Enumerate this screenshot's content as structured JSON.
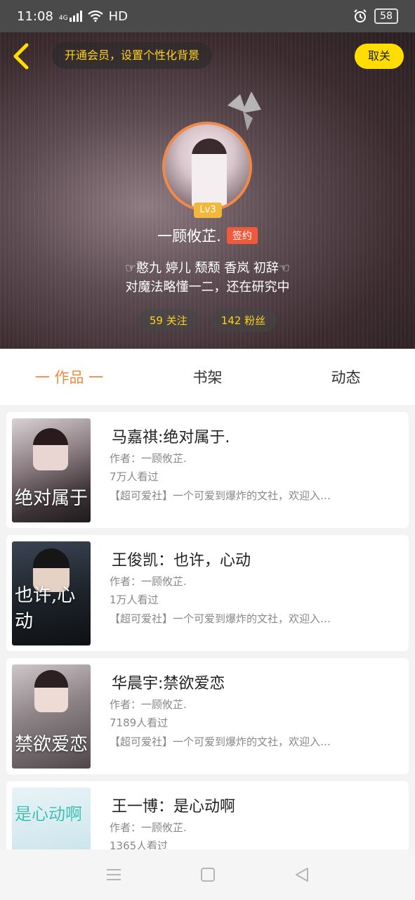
{
  "status_bar": {
    "time": "11:08",
    "network": "4G",
    "hd": "HD",
    "battery": "58"
  },
  "header": {
    "vip_prompt": "开通会员，设置个性化背景",
    "unfollow_label": "取关"
  },
  "profile": {
    "level": "Lv3",
    "username": "一顾攸芷.",
    "sign_badge": "签约",
    "bio_line1": "☞憨九 婷儿 颓颓 香岚 初辞☜",
    "bio_line2": "对魔法略懂一二，还在研究中",
    "following": "59 关注",
    "fans": "142 粉丝"
  },
  "tabs": [
    {
      "label": "一 作品 一",
      "active": true
    },
    {
      "label": "书架",
      "active": false
    },
    {
      "label": "动态",
      "active": false
    }
  ],
  "works": [
    {
      "title": "马嘉祺:绝对属于.",
      "author": "作者：一顾攸芷.",
      "views": "7万人看过",
      "desc": "【超可爱社】一个可爱到爆炸的文社，欢迎入…",
      "cover_text": "绝对属于"
    },
    {
      "title": "王俊凯：也许，心动",
      "author": "作者：一顾攸芷.",
      "views": "1万人看过",
      "desc": "【超可爱社】一个可爱到爆炸的文社，欢迎入…",
      "cover_text": "也许,心动"
    },
    {
      "title": "华晨宇:禁欲爱恋",
      "author": "作者：一顾攸芷.",
      "views": "7189人看过",
      "desc": "【超可爱社】一个可爱到爆炸的文社，欢迎入…",
      "cover_text": "禁欲爱恋"
    },
    {
      "title": "王一博：是心动啊",
      "author": "作者：一顾攸芷.",
      "views": "1365人看过",
      "desc": "",
      "cover_text": "是心动啊"
    }
  ],
  "colors": {
    "accent_yellow": "#ffdd00",
    "accent_orange": "#f0893b",
    "sign_red": "#f05a3c"
  }
}
